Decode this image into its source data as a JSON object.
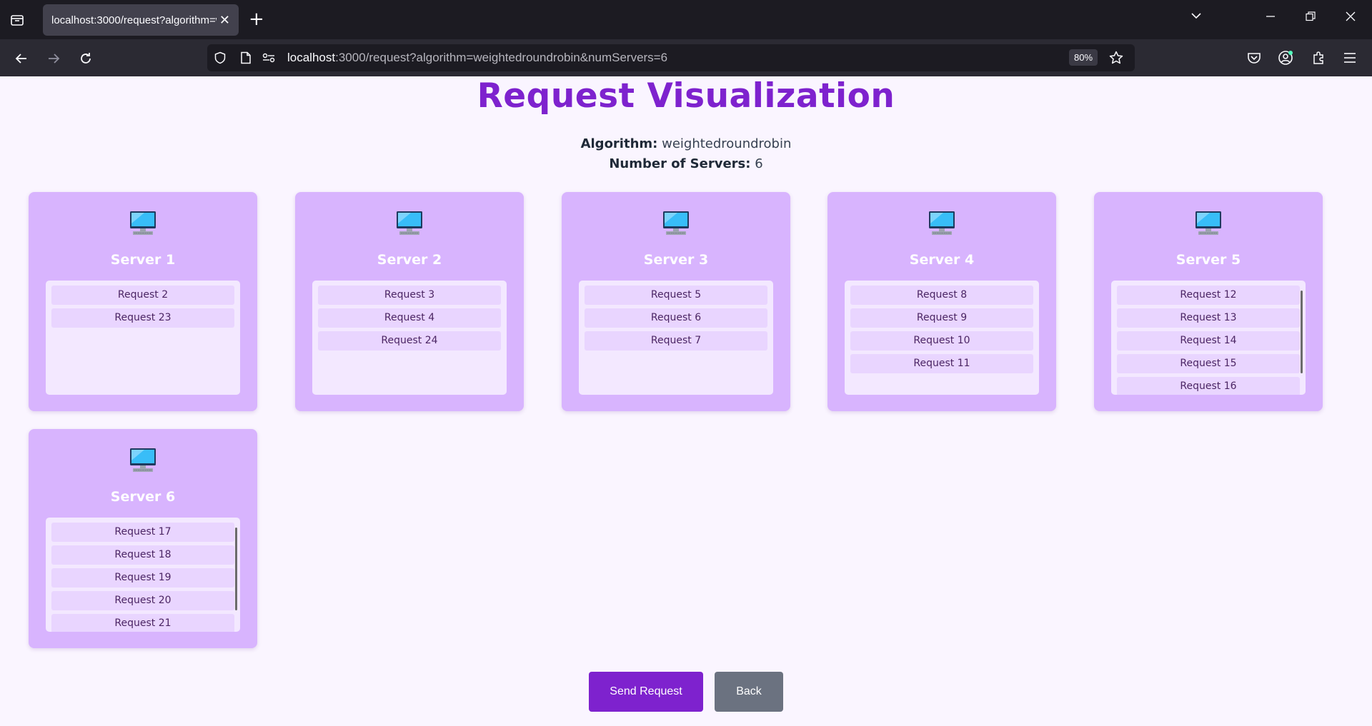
{
  "browser": {
    "tab_title": "localhost:3000/request?algorithm=weightedroundrobin&numServers=6",
    "url_host": "localhost",
    "url_rest": ":3000/request?algorithm=weightedroundrobin&numServers=6",
    "zoom": "80%"
  },
  "page": {
    "title": "Request Visualization",
    "algorithm_label": "Algorithm:",
    "algorithm_value": "weightedroundrobin",
    "servers_label": "Number of Servers:",
    "servers_value": "6"
  },
  "servers": [
    {
      "name": "Server 1",
      "requests": [
        "Request 2",
        "Request 23"
      ],
      "scroll": false
    },
    {
      "name": "Server 2",
      "requests": [
        "Request 3",
        "Request 4",
        "Request 24"
      ],
      "scroll": false
    },
    {
      "name": "Server 3",
      "requests": [
        "Request 5",
        "Request 6",
        "Request 7"
      ],
      "scroll": false
    },
    {
      "name": "Server 4",
      "requests": [
        "Request 8",
        "Request 9",
        "Request 10",
        "Request 11"
      ],
      "scroll": false
    },
    {
      "name": "Server 5",
      "requests": [
        "Request 12",
        "Request 13",
        "Request 14",
        "Request 15",
        "Request 16"
      ],
      "scroll": true
    },
    {
      "name": "Server 6",
      "requests": [
        "Request 17",
        "Request 18",
        "Request 19",
        "Request 20",
        "Request 21"
      ],
      "scroll": true
    }
  ],
  "actions": {
    "send_label": "Send Request",
    "back_label": "Back"
  },
  "colors": {
    "accent": "#7e22ce",
    "card": "#d8b4fe",
    "request_box": "#f3e8ff",
    "request_item": "#e9d5ff",
    "back_button": "#6b7280"
  }
}
